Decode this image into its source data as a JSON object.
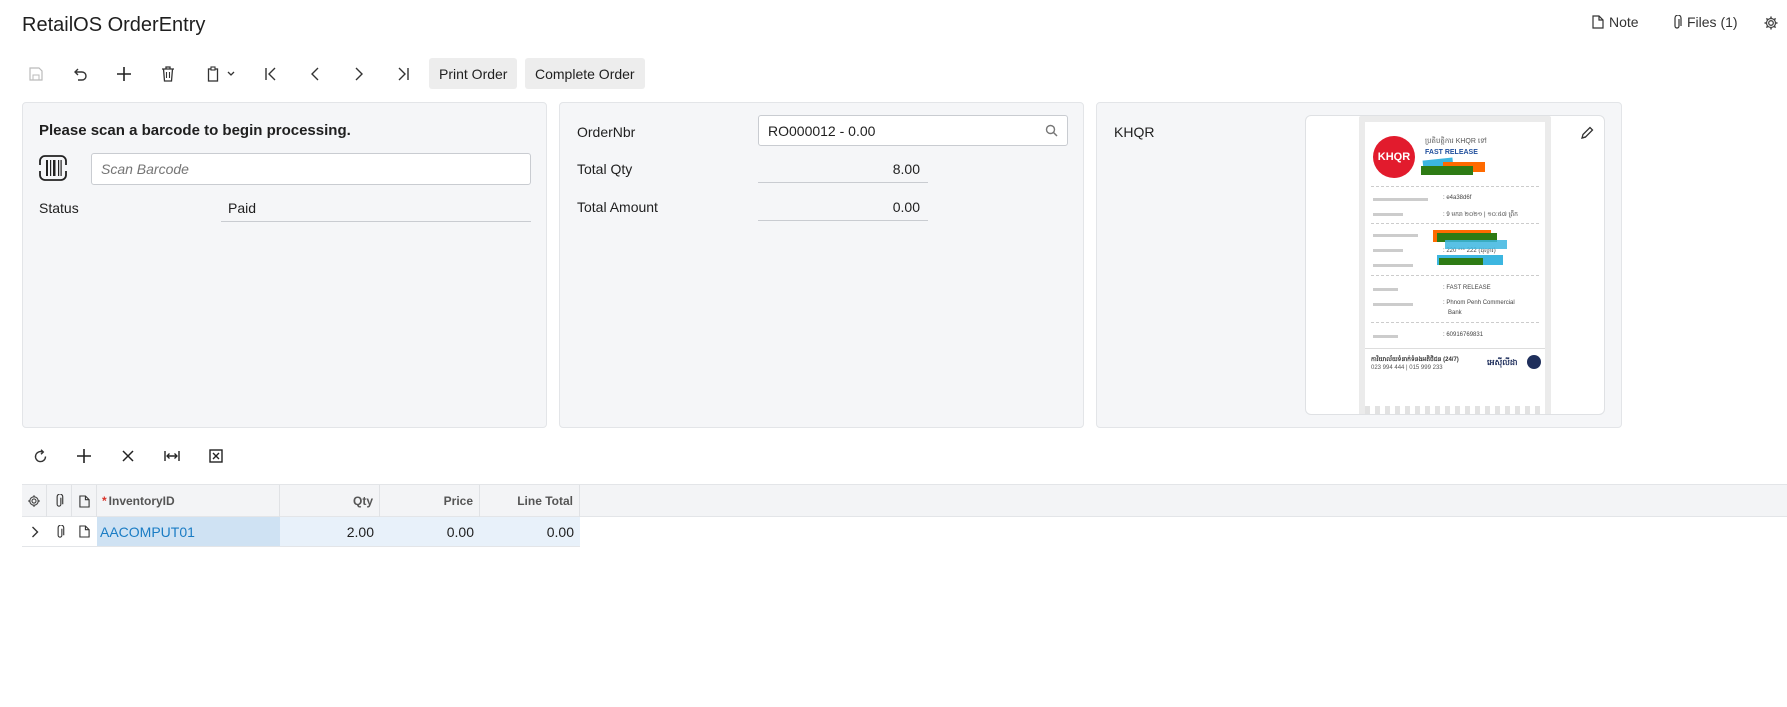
{
  "app": {
    "title": "RetailOS OrderEntry"
  },
  "header_actions": {
    "note_label": "Note",
    "files_label": "Files (1)"
  },
  "toolbar": {
    "print_label": "Print Order",
    "complete_label": "Complete Order"
  },
  "scan_panel": {
    "heading": "Please scan a barcode to begin processing.",
    "barcode_placeholder": "Scan Barcode",
    "status_label": "Status",
    "status_value": "Paid"
  },
  "order_panel": {
    "order_nbr_label": "OrderNbr",
    "order_nbr_value": "RO000012 - 0.00",
    "total_qty_label": "Total Qty",
    "total_qty_value": "8.00",
    "total_amount_label": "Total Amount",
    "total_amount_value": "0.00"
  },
  "khqr_panel": {
    "label": "KHQR",
    "receipt": {
      "logo_text": "KHQR",
      "title_line": "ប្រតិបត្តិការ KHQR ទៅ",
      "merchant": "FAST RELEASE",
      "ref_value": ": e4a38d6f",
      "date_value": ": 9 មករា ២០២១ | ១០:៥៧ ព្រឹក",
      "account_value": ": 220 *** 222 (ដុល្លារ)",
      "recipient_value": ": FAST RELEASE",
      "bank_value_1": ": Phnom Penh Commercial",
      "bank_value_2": "Bank",
      "hash_value": ": 60916769831",
      "footer_line_1": "ការិយាល័យទំនាក់ទំនងអតិថិជន (24/7)",
      "footer_line_2": "023 994 444 | 015 999 233",
      "bank_brand": "អេស៊ីលីដា"
    }
  },
  "grid": {
    "columns": {
      "inventory": "InventoryID",
      "qty": "Qty",
      "price": "Price",
      "line_total": "Line Total"
    },
    "rows": [
      {
        "inventory": "AACOMPUT01",
        "qty": "2.00",
        "price": "0.00",
        "line_total": "0.00"
      }
    ]
  },
  "colors": {
    "accent": "#1a7cc4",
    "card_bg": "#f5f6f8",
    "selected_row": "#cfe2f3",
    "required": "#d9342b"
  }
}
